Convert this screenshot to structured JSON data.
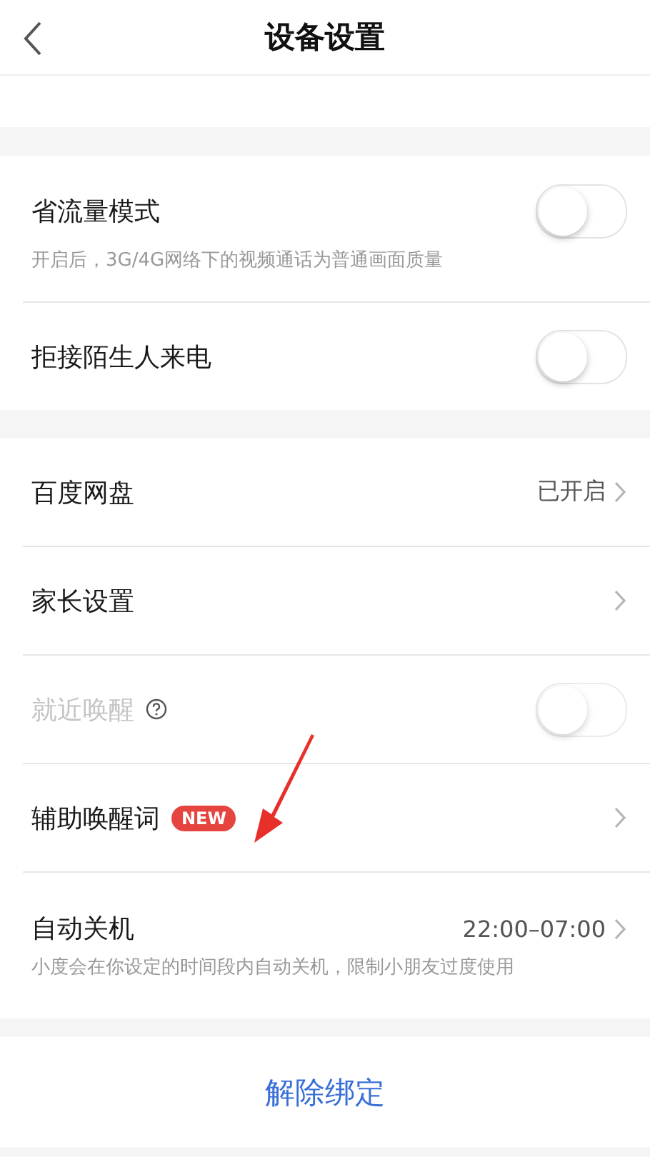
{
  "header": {
    "title": "设备设置"
  },
  "groups": [
    {
      "items": [
        {
          "kind": "switch",
          "label": "省流量模式",
          "subtitle": "开启后，3G/4G网络下的视频通话为普通画面质量",
          "on": false,
          "disabled": false
        },
        {
          "kind": "switch",
          "label": "拒接陌生人来电",
          "on": false,
          "disabled": false
        }
      ]
    },
    {
      "items": [
        {
          "kind": "link",
          "label": "百度网盘",
          "value": "已开启"
        },
        {
          "kind": "link",
          "label": "家长设置"
        },
        {
          "kind": "switch",
          "label": "就近唤醒",
          "help": true,
          "on": false,
          "disabled": true
        },
        {
          "kind": "link",
          "label": "辅助唤醒词",
          "badge": "NEW"
        },
        {
          "kind": "link",
          "label": "自动关机",
          "value": "22:00–07:00",
          "subtitle": "小度会在你设定的时间段内自动关机，限制小朋友过度使用"
        }
      ]
    }
  ],
  "footer_button": "解除绑定"
}
